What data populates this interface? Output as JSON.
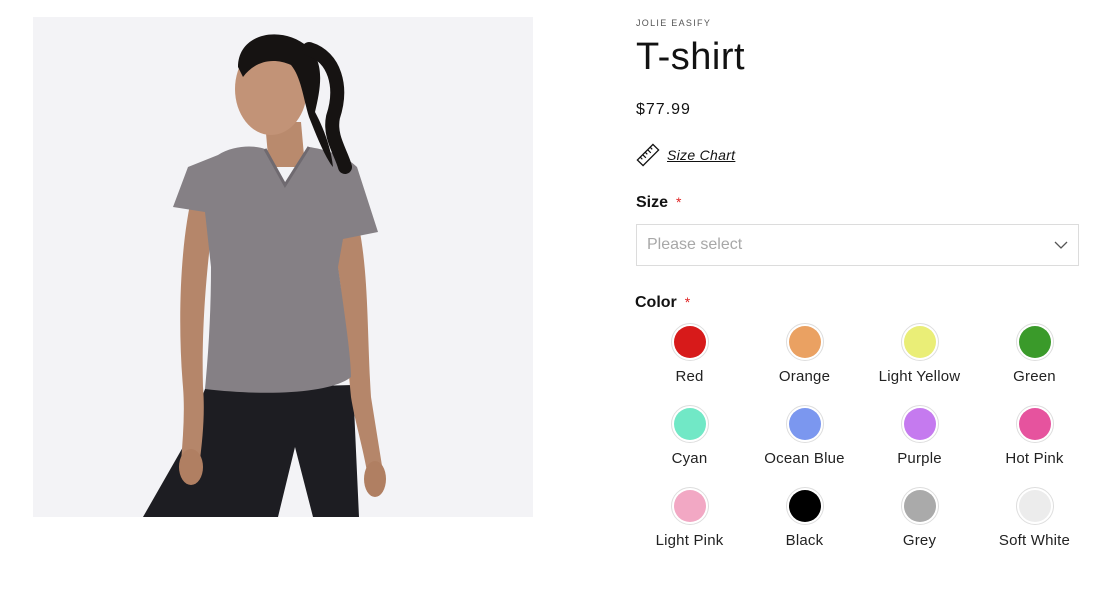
{
  "product": {
    "vendor": "JOLIE EASIFY",
    "title": "T-shirt",
    "price": "$77.99",
    "size_chart_label": "Size Chart",
    "size_chart_icon": "ruler-icon",
    "image_icon": "product-photo-woman-grey-tshirt"
  },
  "size_field": {
    "label": "Size",
    "required_mark": "*",
    "placeholder": "Please select",
    "icon": "chevron-down-icon"
  },
  "color_field": {
    "label": "Color",
    "required_mark": "*",
    "options": [
      {
        "name": "Red",
        "hex": "#d71a1a"
      },
      {
        "name": "Orange",
        "hex": "#eaa162"
      },
      {
        "name": "Light Yellow",
        "hex": "#eaee77"
      },
      {
        "name": "Green",
        "hex": "#3a9a2a"
      },
      {
        "name": "Cyan",
        "hex": "#71e8c6"
      },
      {
        "name": "Ocean Blue",
        "hex": "#7b97ef"
      },
      {
        "name": "Purple",
        "hex": "#c57aef"
      },
      {
        "name": "Hot Pink",
        "hex": "#e6539e"
      },
      {
        "name": "Light Pink",
        "hex": "#f2a8c4"
      },
      {
        "name": "Black",
        "hex": "#000000"
      },
      {
        "name": "Grey",
        "hex": "#aaaaaa"
      },
      {
        "name": "Soft White",
        "hex": "#ececec"
      }
    ]
  },
  "colors": {
    "required": "#e02424",
    "text": "#121212",
    "border": "#dcdcdc",
    "image_bg": "#f3f3f6"
  }
}
